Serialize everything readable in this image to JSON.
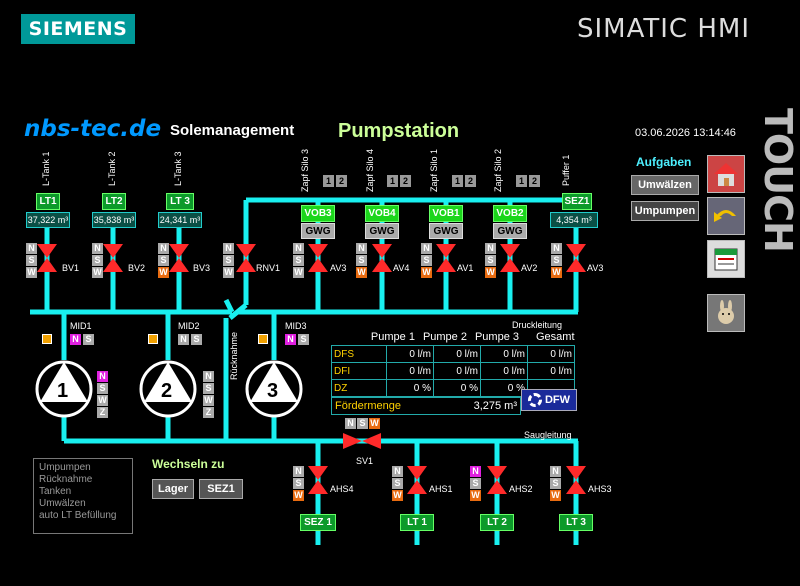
{
  "header": {
    "brand": "SIEMENS",
    "product": "SIMATIC HMI",
    "site": "nbs-tec.de",
    "subtitle": "Solemanagement",
    "title": "Pumpstation",
    "datetime": "03.06.2026 13:14:46",
    "touch": "TOUCH"
  },
  "tanks": [
    {
      "tag": "L-Tank 1",
      "btn": "LT1",
      "vol": "37,322 m³",
      "valve": "BV1"
    },
    {
      "tag": "L-Tank 2",
      "btn": "LT2",
      "vol": "35,838 m³",
      "valve": "BV2"
    },
    {
      "tag": "L-Tank 3",
      "btn": "LT 3",
      "vol": "24,341 m³",
      "valve": "BV3"
    }
  ],
  "rnv": "RNV1",
  "silos": [
    {
      "tag": "Zapf Silo 3",
      "btn": "VOB3",
      "gwg": "GWG",
      "valve": "AV3"
    },
    {
      "tag": "Zapf Silo 4",
      "btn": "VOB4",
      "gwg": "GWG",
      "valve": "AV4"
    },
    {
      "tag": "Zapf Silo 1",
      "btn": "VOB1",
      "gwg": "GWG",
      "valve": "AV1"
    },
    {
      "tag": "Zapf Silo 2",
      "btn": "VOB2",
      "gwg": "GWG",
      "valve": "AV2"
    }
  ],
  "puffer": {
    "tag": "Puffer 1",
    "btn": "SEZ1",
    "vol": "4,354 m³",
    "valve": "AV3"
  },
  "twelve": [
    "1",
    "2"
  ],
  "aufgaben": {
    "label": "Aufgaben",
    "btn1": "Umwälzen",
    "btn2": "Umpumpen"
  },
  "pumps": [
    {
      "num": "1",
      "mid": "MID1"
    },
    {
      "num": "2",
      "mid": "MID2"
    },
    {
      "num": "3",
      "mid": "MID3"
    }
  ],
  "ruecknahme": "Rücknahme",
  "druckleitung": "Druckleitung",
  "saugleitung": "Saugleitung",
  "table": {
    "headers": [
      "Pumpe 1",
      "Pumpe 2",
      "Pumpe 3",
      "Gesamt"
    ],
    "rows": [
      {
        "label": "DFS",
        "vals": [
          "0 l/m",
          "0 l/m",
          "0 l/m",
          "0 l/m"
        ]
      },
      {
        "label": "DFI",
        "vals": [
          "0 l/m",
          "0 l/m",
          "0 l/m",
          "0 l/m"
        ]
      },
      {
        "label": "DZ",
        "vals": [
          "0 %",
          "0 %",
          "0 %"
        ]
      }
    ],
    "foerder_label": "Fördermenge",
    "foerder_val": "3,275 m³",
    "dfw": "DFW"
  },
  "sv": "SV1",
  "ahs": [
    {
      "valve": "AHS4",
      "btn": "SEZ 1"
    },
    {
      "valve": "AHS1",
      "btn": "LT 1"
    },
    {
      "valve": "AHS2",
      "btn": "LT 2"
    },
    {
      "valve": "AHS3",
      "btn": "LT 3"
    }
  ],
  "menu": [
    "Umpumpen",
    "Rücknahme",
    "Tanken",
    "Umwälzen",
    "auto LT Befüllung"
  ],
  "wechseln": {
    "label": "Wechseln zu",
    "btn1": "Lager",
    "btn2": "SEZ1"
  },
  "nsw": {
    "n": "N",
    "s": "S",
    "w": "W",
    "z": "Z"
  },
  "colors": {
    "pipe": "#19f0f0",
    "valve": "#ff2a2a",
    "green": "#0c9a2a"
  }
}
